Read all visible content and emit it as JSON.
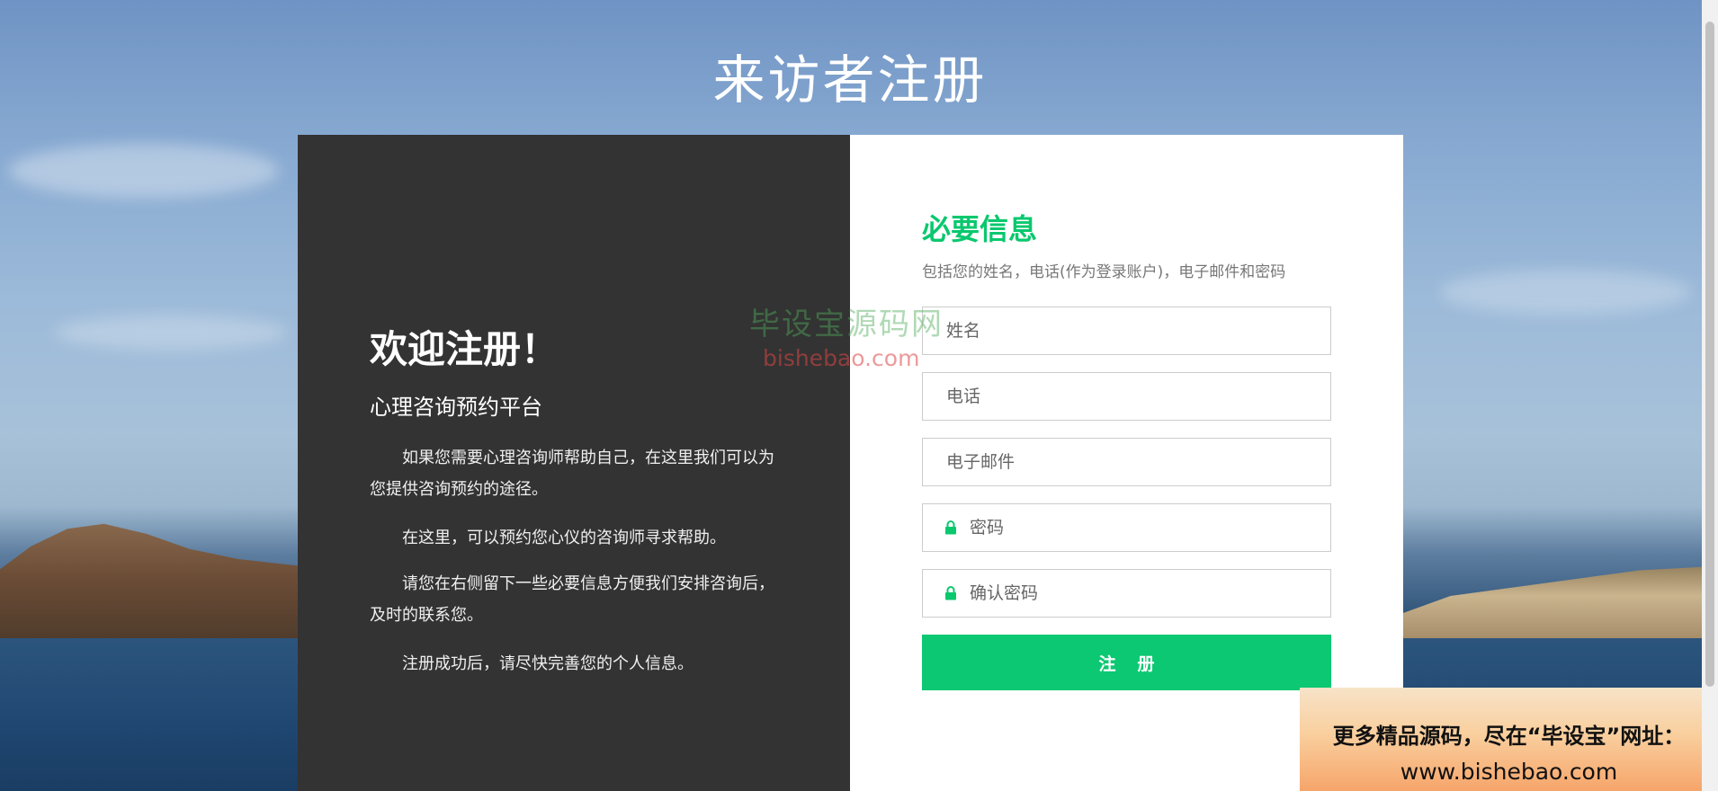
{
  "page": {
    "title": "来访者注册"
  },
  "intro": {
    "welcome": "欢迎注册！",
    "platform": "心理咨询预约平台",
    "paragraphs": [
      "如果您需要心理咨询师帮助自己，在这里我们可以为您提供咨询预约的途径。",
      "在这里，可以预约您心仪的咨询师寻求帮助。",
      "请您在右侧留下一些必要信息方便我们安排咨询后，及时的联系您。",
      "注册成功后，请尽快完善您的个人信息。"
    ]
  },
  "form": {
    "title": "必要信息",
    "subtitle": "包括您的姓名，电话(作为登录账户)，电子邮件和密码",
    "fields": {
      "name": {
        "placeholder": "姓名",
        "value": ""
      },
      "phone": {
        "placeholder": "电话",
        "value": ""
      },
      "email": {
        "placeholder": "电子邮件",
        "value": ""
      },
      "password": {
        "placeholder": "密码",
        "value": ""
      },
      "confirm": {
        "placeholder": "确认密码",
        "value": ""
      }
    },
    "submit_label": "注册"
  },
  "watermark": {
    "cn": "毕设宝源码网",
    "url": "bishebao.com"
  },
  "promo": {
    "line1": "更多精品源码，尽在“毕设宝”网址：",
    "line2": "www.bishebao.com"
  },
  "colors": {
    "accent": "#0ac86e",
    "panel_dark": "#333333"
  },
  "icons": {
    "password_icon": "lock-icon"
  }
}
